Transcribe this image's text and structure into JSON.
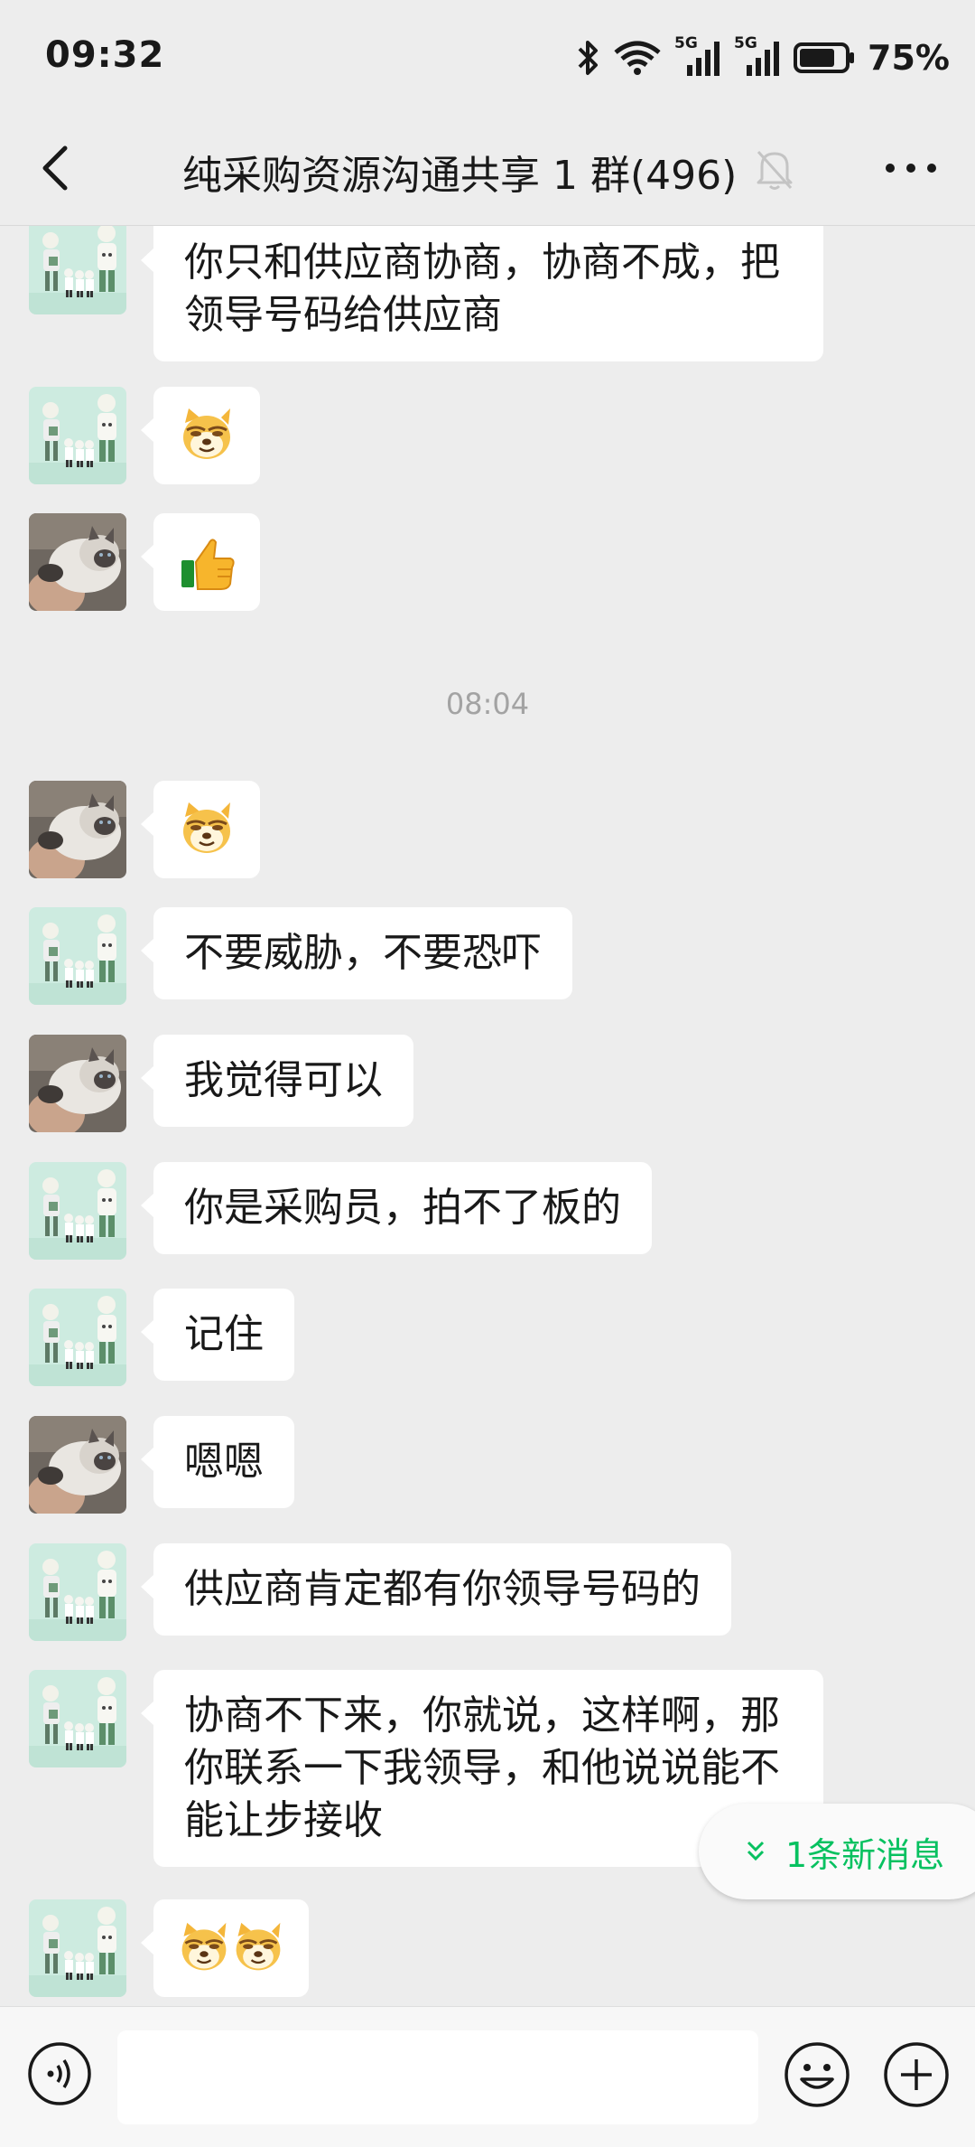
{
  "status": {
    "time": "09:32",
    "battery": "75%",
    "sig1": "5G",
    "sig2": "5G"
  },
  "header": {
    "title": "纯采购资源沟通共享 1 群(496)"
  },
  "chat": {
    "timestamp": "08:04",
    "messages": [
      {
        "avatar": "family-avatar",
        "text": "你只和供应商协商，协商不成，把\n领导号码给供应商"
      },
      {
        "avatar": "family-avatar",
        "emoji": "doge"
      },
      {
        "avatar": "cat-avatar",
        "emoji": "thumbs-up"
      },
      {
        "avatar": "cat-avatar",
        "emoji": "doge"
      },
      {
        "avatar": "family-avatar",
        "text": "不要威胁，不要恐吓"
      },
      {
        "avatar": "cat-avatar",
        "text": "我觉得可以"
      },
      {
        "avatar": "family-avatar",
        "text": "你是采购员，拍不了板的"
      },
      {
        "avatar": "family-avatar",
        "text": "记住"
      },
      {
        "avatar": "cat-avatar",
        "text": "嗯嗯"
      },
      {
        "avatar": "family-avatar",
        "text": "供应商肯定都有你领导号码的"
      },
      {
        "avatar": "family-avatar",
        "text": "协商不下来，你就说，这样啊，那\n你联系一下我领导，和他说说能不\n能让步接收"
      },
      {
        "avatar": "family-avatar",
        "emoji": "doge doge"
      }
    ]
  },
  "new_messages": {
    "label": "1条新消息"
  },
  "input": {
    "placeholder": ""
  },
  "colors": {
    "accent": "#07c160",
    "background": "#ededed",
    "bubble": "#ffffff"
  }
}
